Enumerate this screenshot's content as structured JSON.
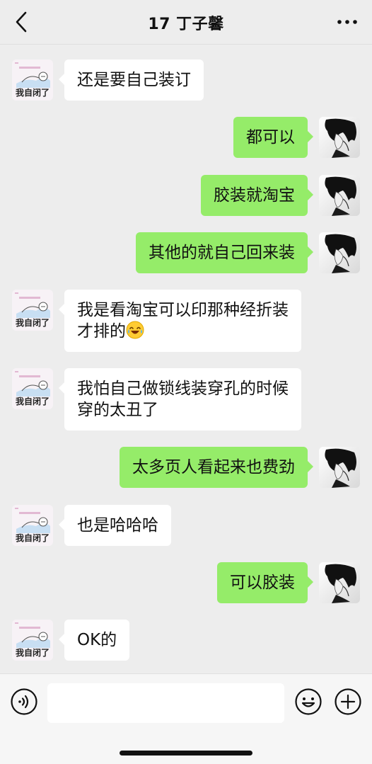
{
  "header": {
    "title": "17 丁子馨",
    "back_icon": "chevron-left-icon",
    "more_icon": "more-dots-icon"
  },
  "contact_avatar_text": "我自闭了",
  "messages": [
    {
      "side": "left",
      "text": "还是要自己装订"
    },
    {
      "side": "right",
      "text": "都可以"
    },
    {
      "side": "right",
      "text": "胶装就淘宝"
    },
    {
      "side": "right",
      "text": "其他的就自己回来装"
    },
    {
      "side": "left",
      "text": "我是看淘宝可以印那种经折装\n才排的"
    },
    {
      "side": "left",
      "text": "我怕自己做锁线装穿孔的时候\n穿的太丑了"
    },
    {
      "side": "right",
      "text": "太多页人看起来也费劲"
    },
    {
      "side": "left",
      "text": "也是哈哈哈"
    },
    {
      "side": "right",
      "text": "可以胶装"
    },
    {
      "side": "left",
      "text": "OK的"
    }
  ],
  "input_bar": {
    "text_value": "",
    "voice_icon": "voice-icon",
    "emoji_icon": "emoji-icon",
    "plus_icon": "plus-icon"
  },
  "colors": {
    "background": "#ededed",
    "sent_bubble": "#95ec69",
    "received_bubble": "#ffffff"
  }
}
